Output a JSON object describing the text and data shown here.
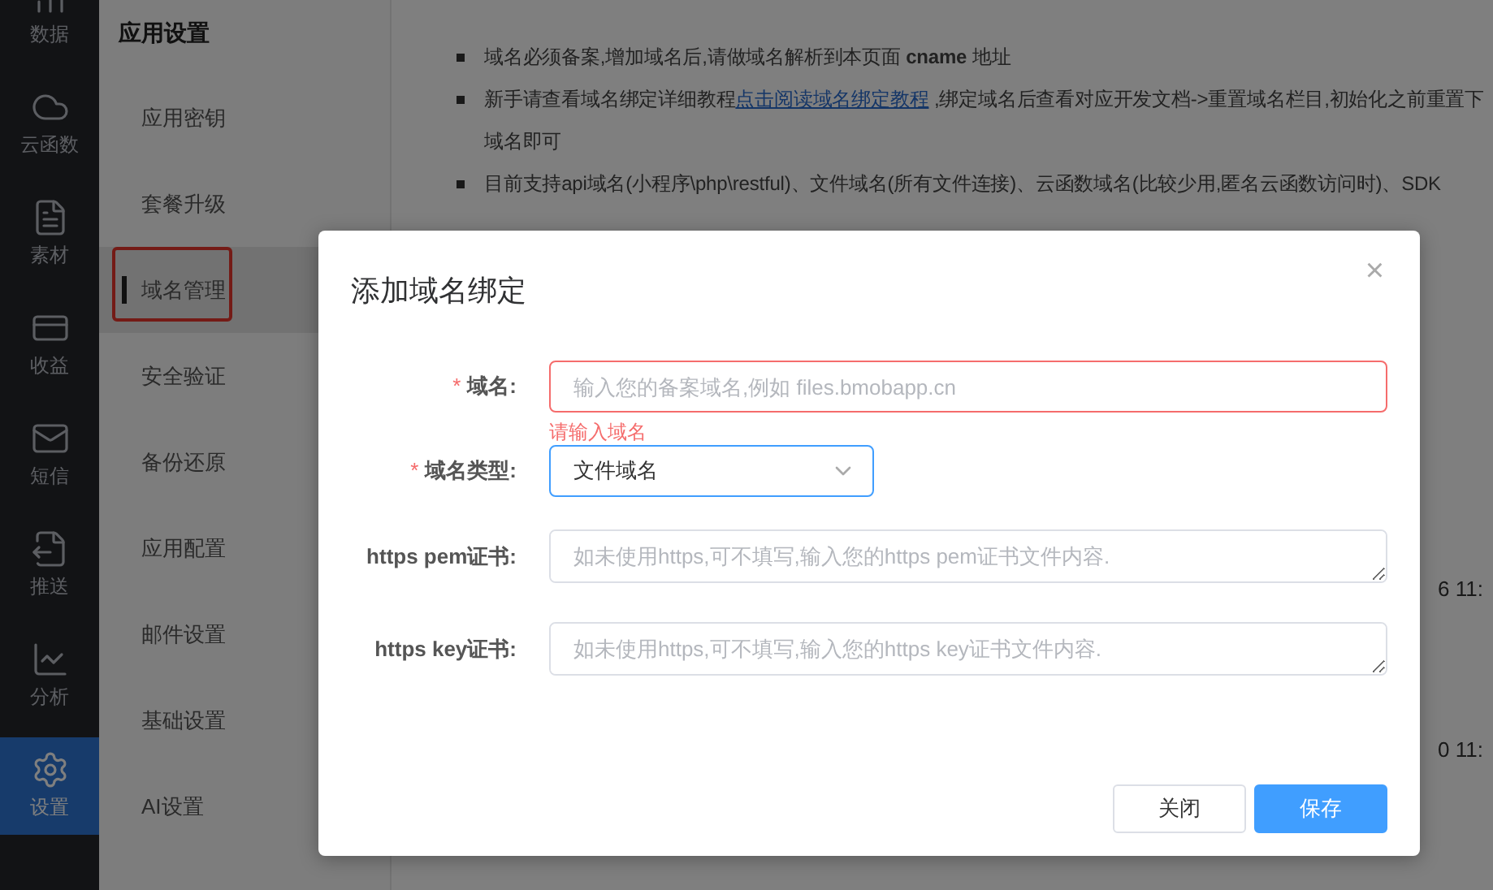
{
  "rail": [
    {
      "label": "数据",
      "selected": false
    },
    {
      "label": "云函数",
      "selected": false
    },
    {
      "label": "素材",
      "selected": false
    },
    {
      "label": "收益",
      "selected": false
    },
    {
      "label": "短信",
      "selected": false
    },
    {
      "label": "推送",
      "selected": false
    },
    {
      "label": "分析",
      "selected": false
    },
    {
      "label": "设置",
      "selected": true
    }
  ],
  "settings_menu": {
    "title": "应用设置",
    "items": [
      {
        "label": "应用密钥",
        "selected": false,
        "highlighted": false
      },
      {
        "label": "套餐升级",
        "selected": false,
        "highlighted": false
      },
      {
        "label": "域名管理",
        "selected": true,
        "highlighted": true
      },
      {
        "label": "安全验证",
        "selected": false,
        "highlighted": false
      },
      {
        "label": "备份还原",
        "selected": false,
        "highlighted": false
      },
      {
        "label": "应用配置",
        "selected": false,
        "highlighted": false
      },
      {
        "label": "邮件设置",
        "selected": false,
        "highlighted": false
      },
      {
        "label": "基础设置",
        "selected": false,
        "highlighted": false
      },
      {
        "label": "AI设置",
        "selected": false,
        "highlighted": false
      }
    ]
  },
  "notes": [
    {
      "before": "域名必须备案,增加域名后,请做域名解析到本页面 **cname** 地址"
    },
    {
      "before": "新手请查看域名绑定详细教程",
      "link": "点击阅读域名绑定教程",
      "after": " ,绑定域名后查看对应开发文档->重置域名栏目,初始化之前重置下域名即可"
    },
    {
      "before": "目前支持api域名(小程序\\php\\restful)、文件域名(所有文件连接)、云函数域名(比较少用,匿名云函数访问时)、SDK"
    }
  ],
  "background_times": [
    "6 11:",
    "0 11:"
  ],
  "dialog": {
    "title": "添加域名绑定",
    "close": "×",
    "required_mark": "*",
    "fields": [
      {
        "kind": "input",
        "label": "域名:",
        "required": true,
        "placeholder": "输入您的备案域名,例如 files.bmobapp.cn",
        "error": "请输入域名"
      },
      {
        "kind": "select",
        "label": "域名类型:",
        "required": true,
        "value": "文件域名"
      },
      {
        "kind": "textarea",
        "label": "https pem证书:",
        "required": false,
        "placeholder": "如未使用https,可不填写,输入您的https pem证书文件内容."
      },
      {
        "kind": "textarea",
        "label": "https key证书:",
        "required": false,
        "placeholder": "如未使用https,可不填写,输入您的https key证书文件内容."
      }
    ],
    "buttons": [
      {
        "label": "关闭",
        "primary": false
      },
      {
        "label": "保存",
        "primary": true
      }
    ]
  }
}
